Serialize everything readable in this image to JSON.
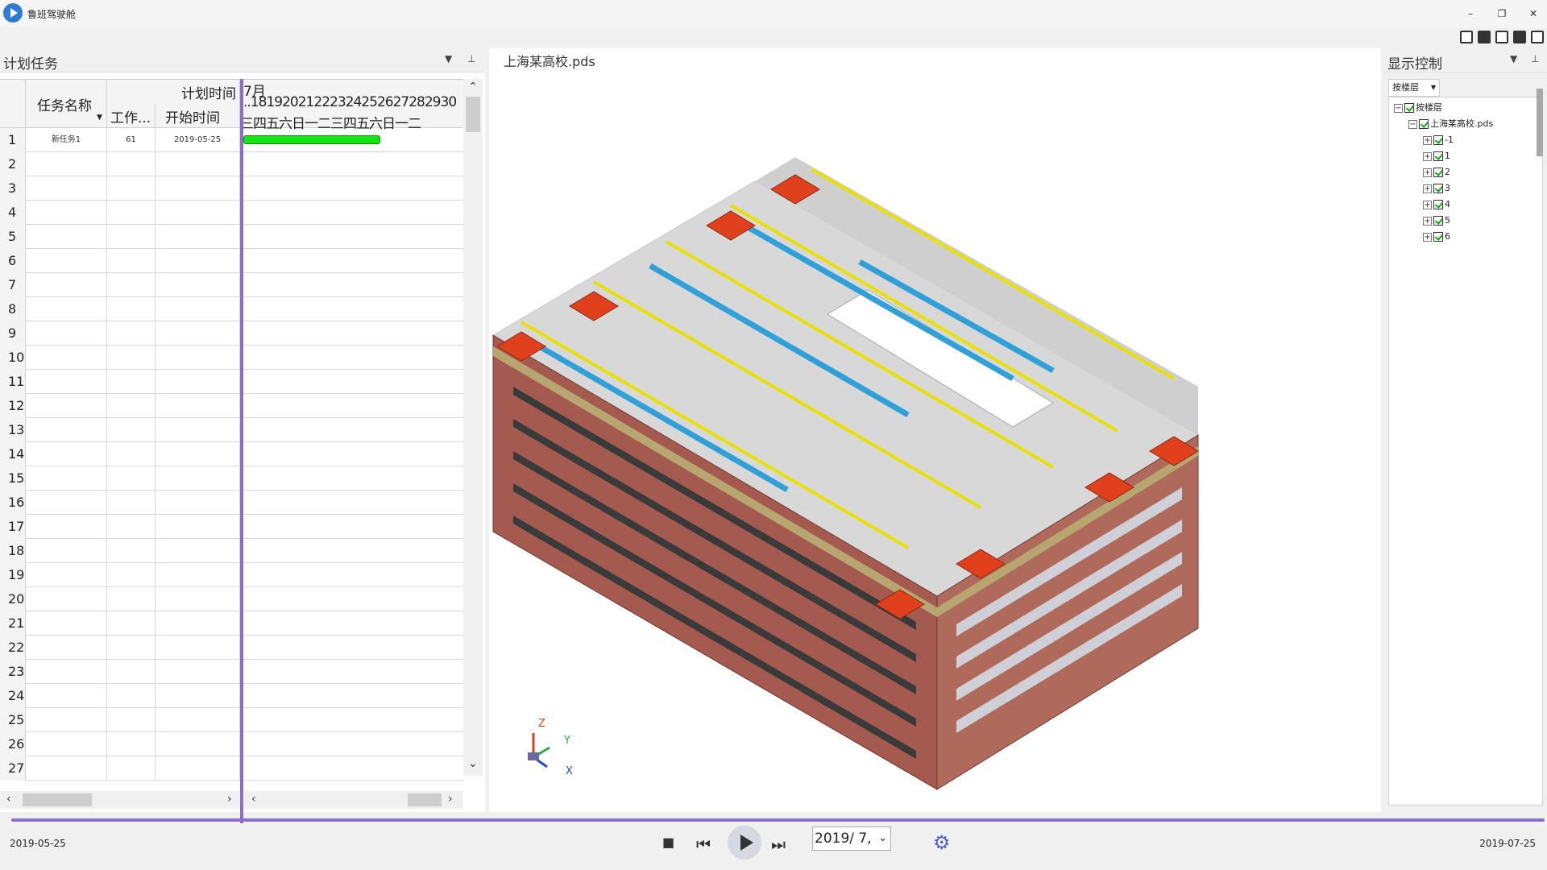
{
  "app": {
    "title": "鲁班驾驶舱"
  },
  "window_controls": {
    "minimize": "–",
    "restore": "❐",
    "close": "✕"
  },
  "left_panel": {
    "title": "计划任务",
    "columns": {
      "task_name": "任务名称",
      "plan_time": "计划时间",
      "work": "工作...",
      "start": "开始时间"
    },
    "month": "7月",
    "days": [
      "..18",
      "19",
      "20",
      "21",
      "22",
      "23",
      "24",
      "25",
      "26",
      "27",
      "28",
      "29",
      "30"
    ],
    "weekdays": [
      "三",
      "四",
      "五",
      "六",
      "日",
      "一",
      "二",
      "三",
      "四",
      "五",
      "六",
      "日",
      "一",
      "二"
    ],
    "rows": [
      {
        "num": "1",
        "name": "新任务1",
        "work": "61",
        "start": "2019-05-25"
      },
      {
        "num": "2"
      },
      {
        "num": "3"
      },
      {
        "num": "4"
      },
      {
        "num": "5"
      },
      {
        "num": "6"
      },
      {
        "num": "7"
      },
      {
        "num": "8"
      },
      {
        "num": "9"
      },
      {
        "num": "10"
      },
      {
        "num": "11"
      },
      {
        "num": "12"
      },
      {
        "num": "13"
      },
      {
        "num": "14"
      },
      {
        "num": "15"
      },
      {
        "num": "16"
      },
      {
        "num": "17"
      },
      {
        "num": "18"
      },
      {
        "num": "19"
      },
      {
        "num": "20"
      },
      {
        "num": "21"
      },
      {
        "num": "22"
      },
      {
        "num": "23"
      },
      {
        "num": "24"
      },
      {
        "num": "25"
      },
      {
        "num": "26"
      },
      {
        "num": "27"
      }
    ]
  },
  "viewport": {
    "model_name": "上海某高校.pds",
    "axis_z": "Z",
    "axis_y": "Y",
    "axis_x": "X"
  },
  "right_panel": {
    "title": "显示控制",
    "floor_select": "按楼层",
    "tree": {
      "root": "按楼层",
      "model": "上海某高校.pds",
      "floors": [
        "-1",
        "1",
        "2",
        "3",
        "4",
        "5",
        "6"
      ]
    }
  },
  "timeline": {
    "start_date": "2019-05-25",
    "end_date": "2019-07-25",
    "current_date": "2019/  7,",
    "play_label": "▶"
  },
  "colors": {
    "accent": "#8c6dc8",
    "gantt_bar": "#12e612"
  }
}
